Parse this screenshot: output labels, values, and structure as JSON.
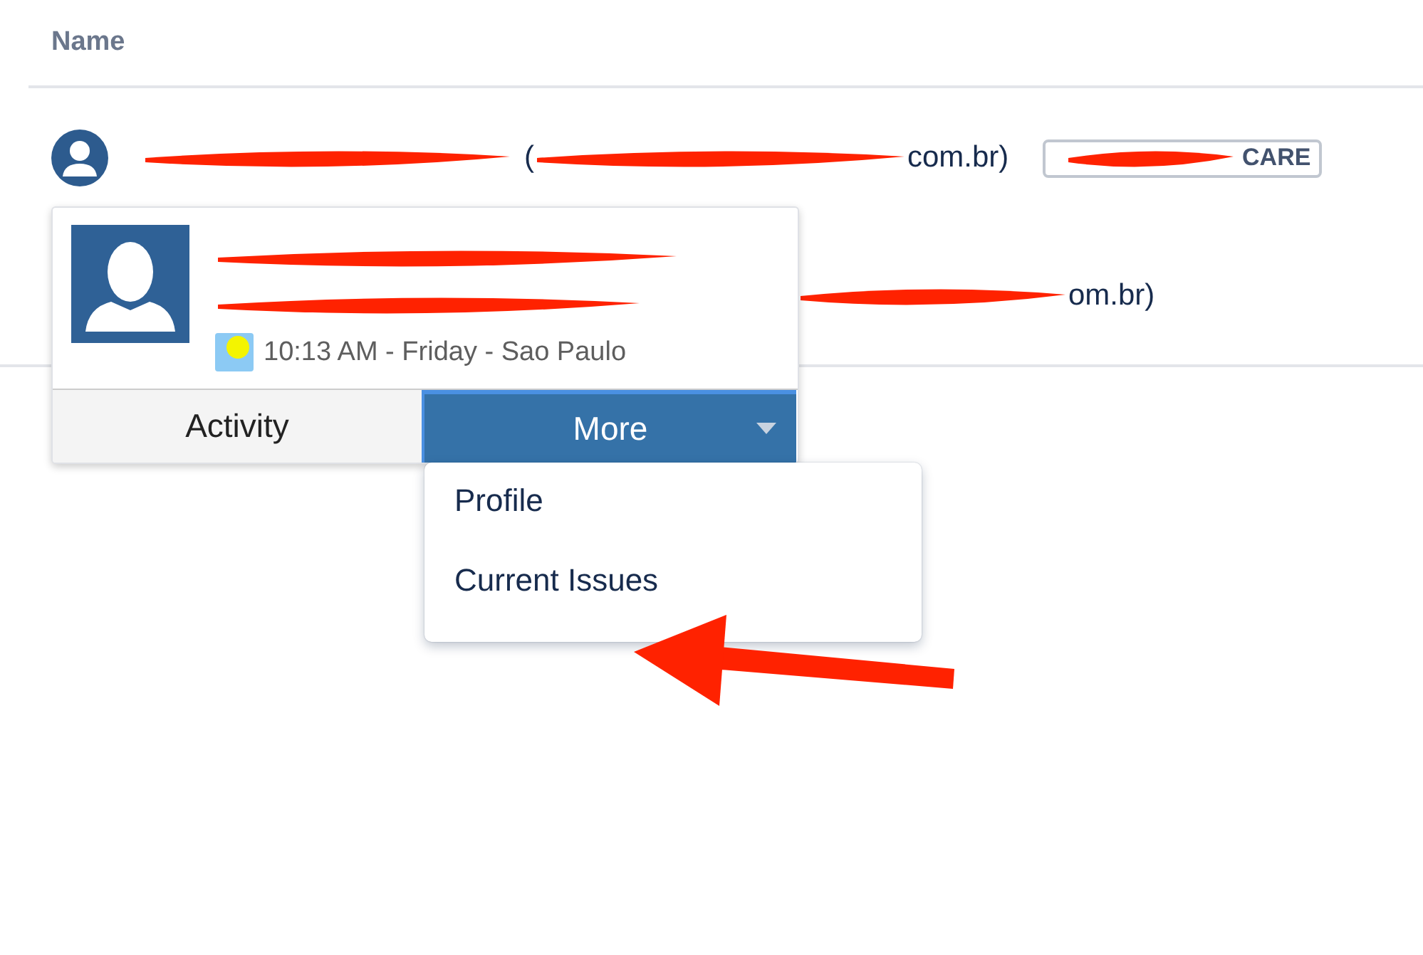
{
  "header": {
    "column": "Name"
  },
  "rows": [
    {
      "open_paren": "(",
      "email_tail": "com.br)",
      "badge": "CARE"
    },
    {
      "email_tail": "om.br)"
    }
  ],
  "hovercard": {
    "time": "10:13 AM - Friday - Sao Paulo",
    "tabs": [
      {
        "label": "Activity",
        "selected": false
      },
      {
        "label": "More",
        "selected": true
      }
    ]
  },
  "menu": {
    "items": [
      "Profile",
      "Current Issues"
    ]
  }
}
